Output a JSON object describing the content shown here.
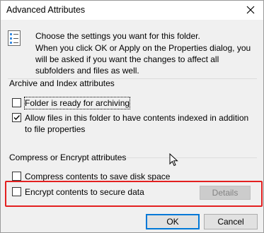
{
  "window": {
    "title": "Advanced Attributes"
  },
  "intro": {
    "line1": "Choose the settings you want for this folder.",
    "line2": "When you click OK or Apply on the Properties dialog, you will be asked if you want the changes to affect all subfolders and files as well."
  },
  "archive_group": {
    "title": "Archive and Index attributes",
    "options": [
      {
        "label": "Folder is ready for archiving",
        "checked": false
      },
      {
        "label": "Allow files in this folder to have contents indexed in addition to file properties",
        "checked": true
      }
    ]
  },
  "compress_group": {
    "title": "Compress or Encrypt attributes",
    "options": [
      {
        "label": "Compress contents to save disk space",
        "checked": false
      },
      {
        "label": "Encrypt contents to secure data",
        "checked": false
      }
    ],
    "details_label": "Details"
  },
  "buttons": {
    "ok": "OK",
    "cancel": "Cancel"
  },
  "colors": {
    "highlight": "#e32020",
    "default_button_border": "#0078d7",
    "disabled_text": "#838383"
  },
  "icons": [
    "close-icon",
    "folder-properties-icon",
    "checkmark-icon",
    "mouse-pointer-icon"
  ]
}
